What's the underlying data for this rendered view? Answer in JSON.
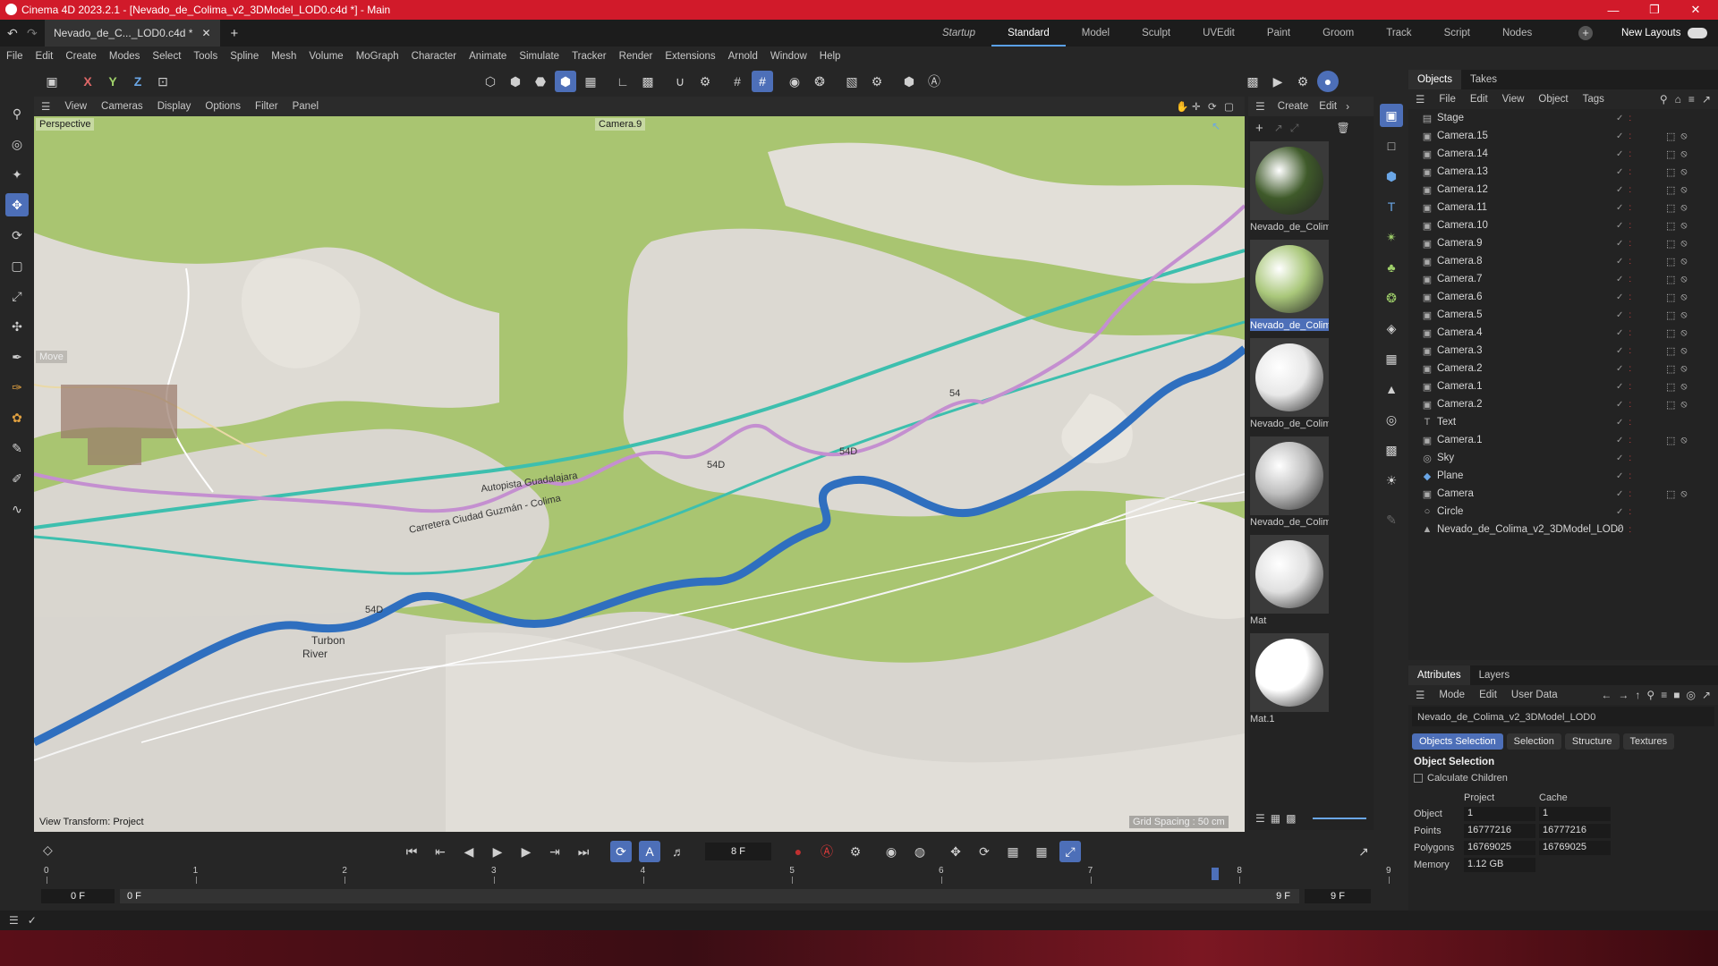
{
  "window": {
    "title": "Cinema 4D 2023.2.1 - [Nevado_de_Colima_v2_3DModel_LOD0.c4d *] - Main"
  },
  "doc_tab": {
    "label": "Nevado_de_C..._LOD0.c4d *",
    "plus": "+"
  },
  "layouts": [
    "Startup",
    "Standard",
    "Model",
    "Sculpt",
    "UVEdit",
    "Paint",
    "Groom",
    "Track",
    "Script",
    "Nodes"
  ],
  "layouts_active": "Standard",
  "new_layouts": "New Layouts",
  "menu": [
    "File",
    "Edit",
    "Create",
    "Modes",
    "Select",
    "Tools",
    "Spline",
    "Mesh",
    "Volume",
    "MoGraph",
    "Character",
    "Animate",
    "Simulate",
    "Tracker",
    "Render",
    "Extensions",
    "Arnold",
    "Window",
    "Help"
  ],
  "axis_buttons": [
    "X",
    "Y",
    "Z"
  ],
  "viewport": {
    "menu": [
      "View",
      "Cameras",
      "Display",
      "Options",
      "Filter",
      "Panel"
    ],
    "camera_mode": "Perspective",
    "camera_name": "Camera.9",
    "tool_hint": "Move",
    "view_transform": "View Transform: Project",
    "grid_spacing": "Grid Spacing : 50 cm",
    "river_label_1": "Turbon",
    "river_label_2": "River",
    "road_labels": [
      "Autopista Guadalajara",
      "Carretera Ciudad Guzmán - Colima",
      "54D",
      "54D",
      "54D",
      "54"
    ]
  },
  "materials": {
    "menu": [
      "Create",
      "Edit"
    ],
    "items": [
      {
        "label": "Nevado_de_Colim",
        "color": "#3f5a2a",
        "selected": false
      },
      {
        "label": "Nevado_de_Colim",
        "color": "#a9c77a",
        "selected": true
      },
      {
        "label": "Nevado_de_Colim",
        "color": "#e8e8e8",
        "selected": false
      },
      {
        "label": "Nevado_de_Colim",
        "color": "#bfbfbf",
        "selected": false
      },
      {
        "label": "Mat",
        "color": "#e0e0e0",
        "selected": false
      },
      {
        "label": "Mat.1",
        "color": "#ffffff",
        "selected": false
      }
    ]
  },
  "objects_panel": {
    "tabs": [
      "Objects",
      "Takes"
    ],
    "menu": [
      "File",
      "Edit",
      "View",
      "Object",
      "Tags"
    ],
    "rows": [
      {
        "name": "Stage"
      },
      {
        "name": "Camera.15"
      },
      {
        "name": "Camera.14"
      },
      {
        "name": "Camera.13"
      },
      {
        "name": "Camera.12"
      },
      {
        "name": "Camera.11"
      },
      {
        "name": "Camera.10"
      },
      {
        "name": "Camera.9"
      },
      {
        "name": "Camera.8"
      },
      {
        "name": "Camera.7"
      },
      {
        "name": "Camera.6"
      },
      {
        "name": "Camera.5"
      },
      {
        "name": "Camera.4"
      },
      {
        "name": "Camera.3"
      },
      {
        "name": "Camera.2"
      },
      {
        "name": "Camera.1"
      },
      {
        "name": "Camera.2"
      },
      {
        "name": "Text"
      },
      {
        "name": "Camera.1"
      },
      {
        "name": "Sky"
      },
      {
        "name": "Plane"
      },
      {
        "name": "Camera"
      },
      {
        "name": "Circle"
      },
      {
        "name": "Nevado_de_Colima_v2_3DModel_LOD0"
      }
    ]
  },
  "attributes": {
    "tabs": [
      "Attributes",
      "Layers"
    ],
    "menu": [
      "Mode",
      "Edit",
      "User Data"
    ],
    "object_name": "Nevado_de_Colima_v2_3DModel_LOD0",
    "buttons": [
      "Objects Selection",
      "Selection",
      "Structure",
      "Textures"
    ],
    "section": "Object Selection",
    "calc_children": "Calculate Children",
    "col_project": "Project",
    "col_cache": "Cache",
    "stats": [
      {
        "label": "Object",
        "project": "1",
        "cache": "1"
      },
      {
        "label": "Points",
        "project": "16777216",
        "cache": "16777216"
      },
      {
        "label": "Polygons",
        "project": "16769025",
        "cache": "16769025"
      },
      {
        "label": "Memory",
        "project": "1.12 GB",
        "cache": ""
      }
    ]
  },
  "timeline": {
    "current_frame": "8 F",
    "ticks": [
      "0",
      "1",
      "2",
      "3",
      "4",
      "5",
      "6",
      "7",
      "8",
      "9"
    ],
    "start": "0 F",
    "range_start": "0 F",
    "range_end": "9 F",
    "end": "9 F"
  }
}
